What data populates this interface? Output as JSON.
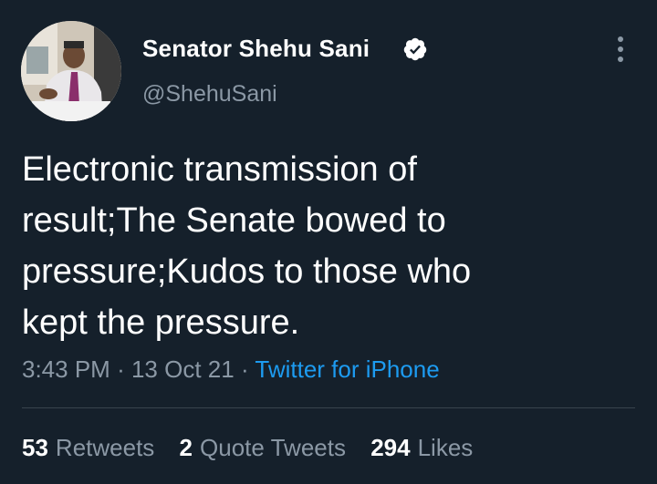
{
  "author": {
    "display_name": "Senator Shehu Sani",
    "handle": "@ShehuSani",
    "verified": true
  },
  "tweet": {
    "lines": [
      "Electronic transmission of",
      "result;The Senate bowed to",
      "pressure;Kudos to those who",
      "kept the pressure."
    ],
    "time": "3:43 PM",
    "date": "13 Oct 21",
    "separator": "·",
    "source": "Twitter for iPhone"
  },
  "stats": {
    "retweets_count": "53",
    "retweets_label": "Retweets",
    "quotes_count": "2",
    "quotes_label": "Quote Tweets",
    "likes_count": "294",
    "likes_label": "Likes"
  },
  "icons": {
    "more": "more-vertical-icon",
    "verified": "verified-badge-icon"
  },
  "colors": {
    "background": "#15202b",
    "primary_text": "#ffffff",
    "secondary_text": "#8b98a5",
    "link": "#1d9bf0",
    "divider": "#38444d"
  }
}
